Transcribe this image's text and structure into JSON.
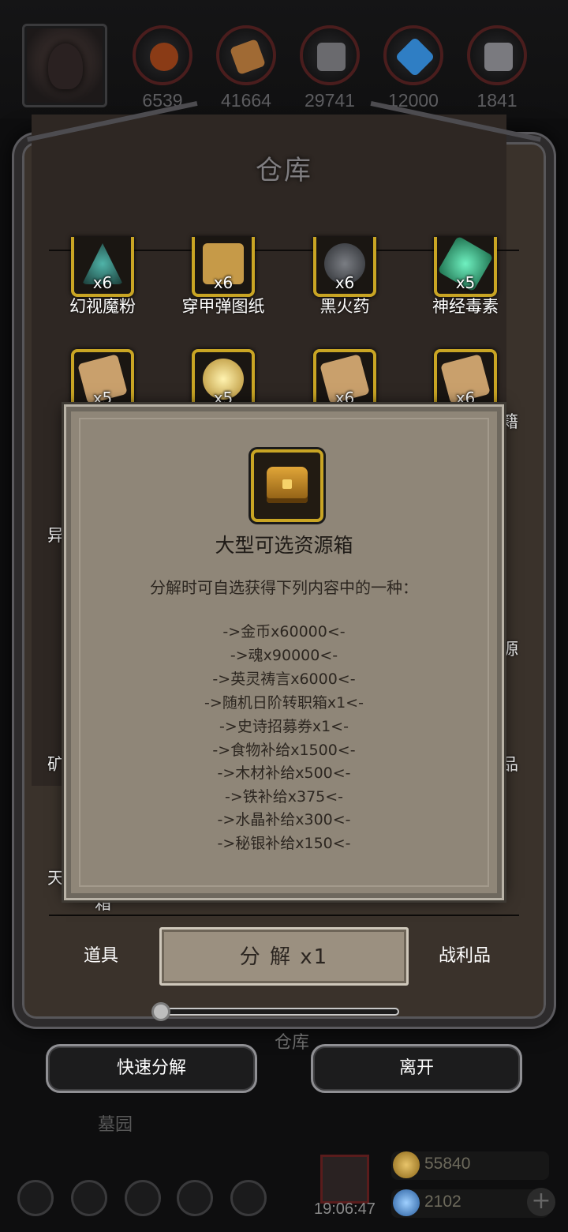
{
  "resources": [
    {
      "name": "food-icon",
      "value": "6539",
      "color": "#8a3b16"
    },
    {
      "name": "wood-icon",
      "value": "41664",
      "color": "#a06a34"
    },
    {
      "name": "iron-icon",
      "value": "29741",
      "color": "#6a6a6e"
    },
    {
      "name": "crystal-icon",
      "value": "12000",
      "color": "#2f7ec4"
    },
    {
      "name": "mithril-icon",
      "value": "1841",
      "color": "#7a7a7f"
    }
  ],
  "warehouse": {
    "title": "仓库",
    "row1": [
      {
        "label": "幻视魔粉",
        "count": "x6",
        "color": "#4fb3a8"
      },
      {
        "label": "穿甲弹图纸",
        "count": "x6",
        "color": "#c69a48"
      },
      {
        "label": "黑火药",
        "count": "x6",
        "color": "#55575c"
      },
      {
        "label": "神经毒素",
        "count": "x5",
        "color": "#3ec48c"
      }
    ],
    "row2": [
      {
        "count": "x5",
        "color": "#c9a06c"
      },
      {
        "count": "x5",
        "color": "#e2c56a"
      },
      {
        "count": "x6",
        "color": "#c9a06c"
      },
      {
        "count": "x6",
        "color": "#c9a06c"
      }
    ],
    "side_texts": {
      "right_1": "籍",
      "left_1": "异",
      "right_2": "源",
      "left_2": "矿",
      "right_3": "品",
      "left_3": "天",
      "bottom_partial": "箱"
    }
  },
  "tabs": {
    "items_tab": "道具",
    "decompose_button": "分 解 x1",
    "spoils_tab": "战利品"
  },
  "below_frame": {
    "title": "仓库",
    "quick_decompose": "快速分解",
    "leave": "离开",
    "cemetery": "墓园"
  },
  "hud": {
    "time": "19:06:47",
    "gold": "55840",
    "gems": "2102",
    "plus": "+"
  },
  "modal": {
    "item_name": "大型可选资源箱",
    "description": "分解时可自选获得下列内容中的一种：",
    "rewards": [
      "->金币x60000<-",
      "->魂x90000<-",
      "->英灵祷言x6000<-",
      "->随机日阶转职箱x1<-",
      "->史诗招募券x1<-",
      "->食物补给x1500<-",
      "->木材补给x500<-",
      "->铁补给x375<-",
      "->水晶补给x300<-",
      "->秘银补给x150<-"
    ]
  },
  "slider_level": 0.0
}
